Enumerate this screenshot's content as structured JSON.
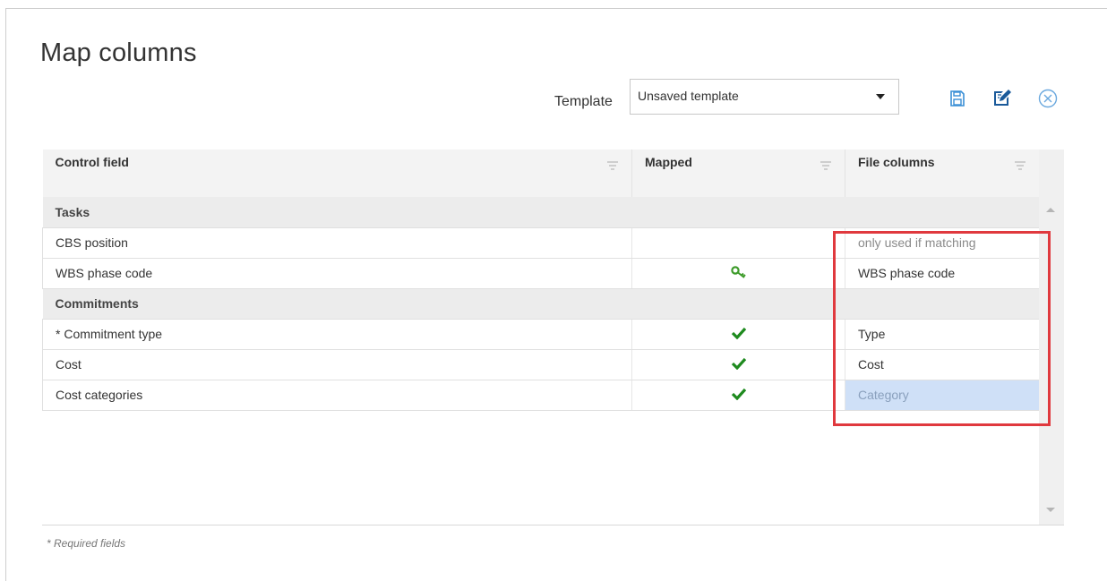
{
  "dialog": {
    "title": "Map columns",
    "template_label": "Template",
    "template_value": "Unsaved template"
  },
  "toolbar": {
    "icons": [
      "save-icon",
      "edit-template-icon",
      "close-icon"
    ],
    "accent_color": "#3a8fd6"
  },
  "grid": {
    "headers": {
      "control_field": "Control field",
      "mapped": "Mapped",
      "file_columns": "File columns"
    },
    "groups": [
      {
        "label": "Tasks",
        "rows": [
          {
            "field": "CBS position",
            "mapped": "",
            "file": "only used if matching",
            "style": "hint"
          },
          {
            "field": "WBS phase code",
            "mapped": "key-icon",
            "file": "WBS phase code",
            "style": ""
          }
        ]
      },
      {
        "label": "Commitments",
        "rows": [
          {
            "field": "* Commitment type",
            "mapped": "check-icon",
            "file": "Type",
            "style": ""
          },
          {
            "field": "Cost",
            "mapped": "check-icon",
            "file": "Cost",
            "style": ""
          },
          {
            "field": "Cost categories",
            "mapped": "check-icon",
            "file": "Category",
            "style": "selected"
          }
        ]
      }
    ],
    "check_color": "#1e8a1e",
    "key_color": "#3d9b2a",
    "highlight_color": "#e0393e"
  },
  "footer": {
    "required_note": "* Required fields"
  }
}
